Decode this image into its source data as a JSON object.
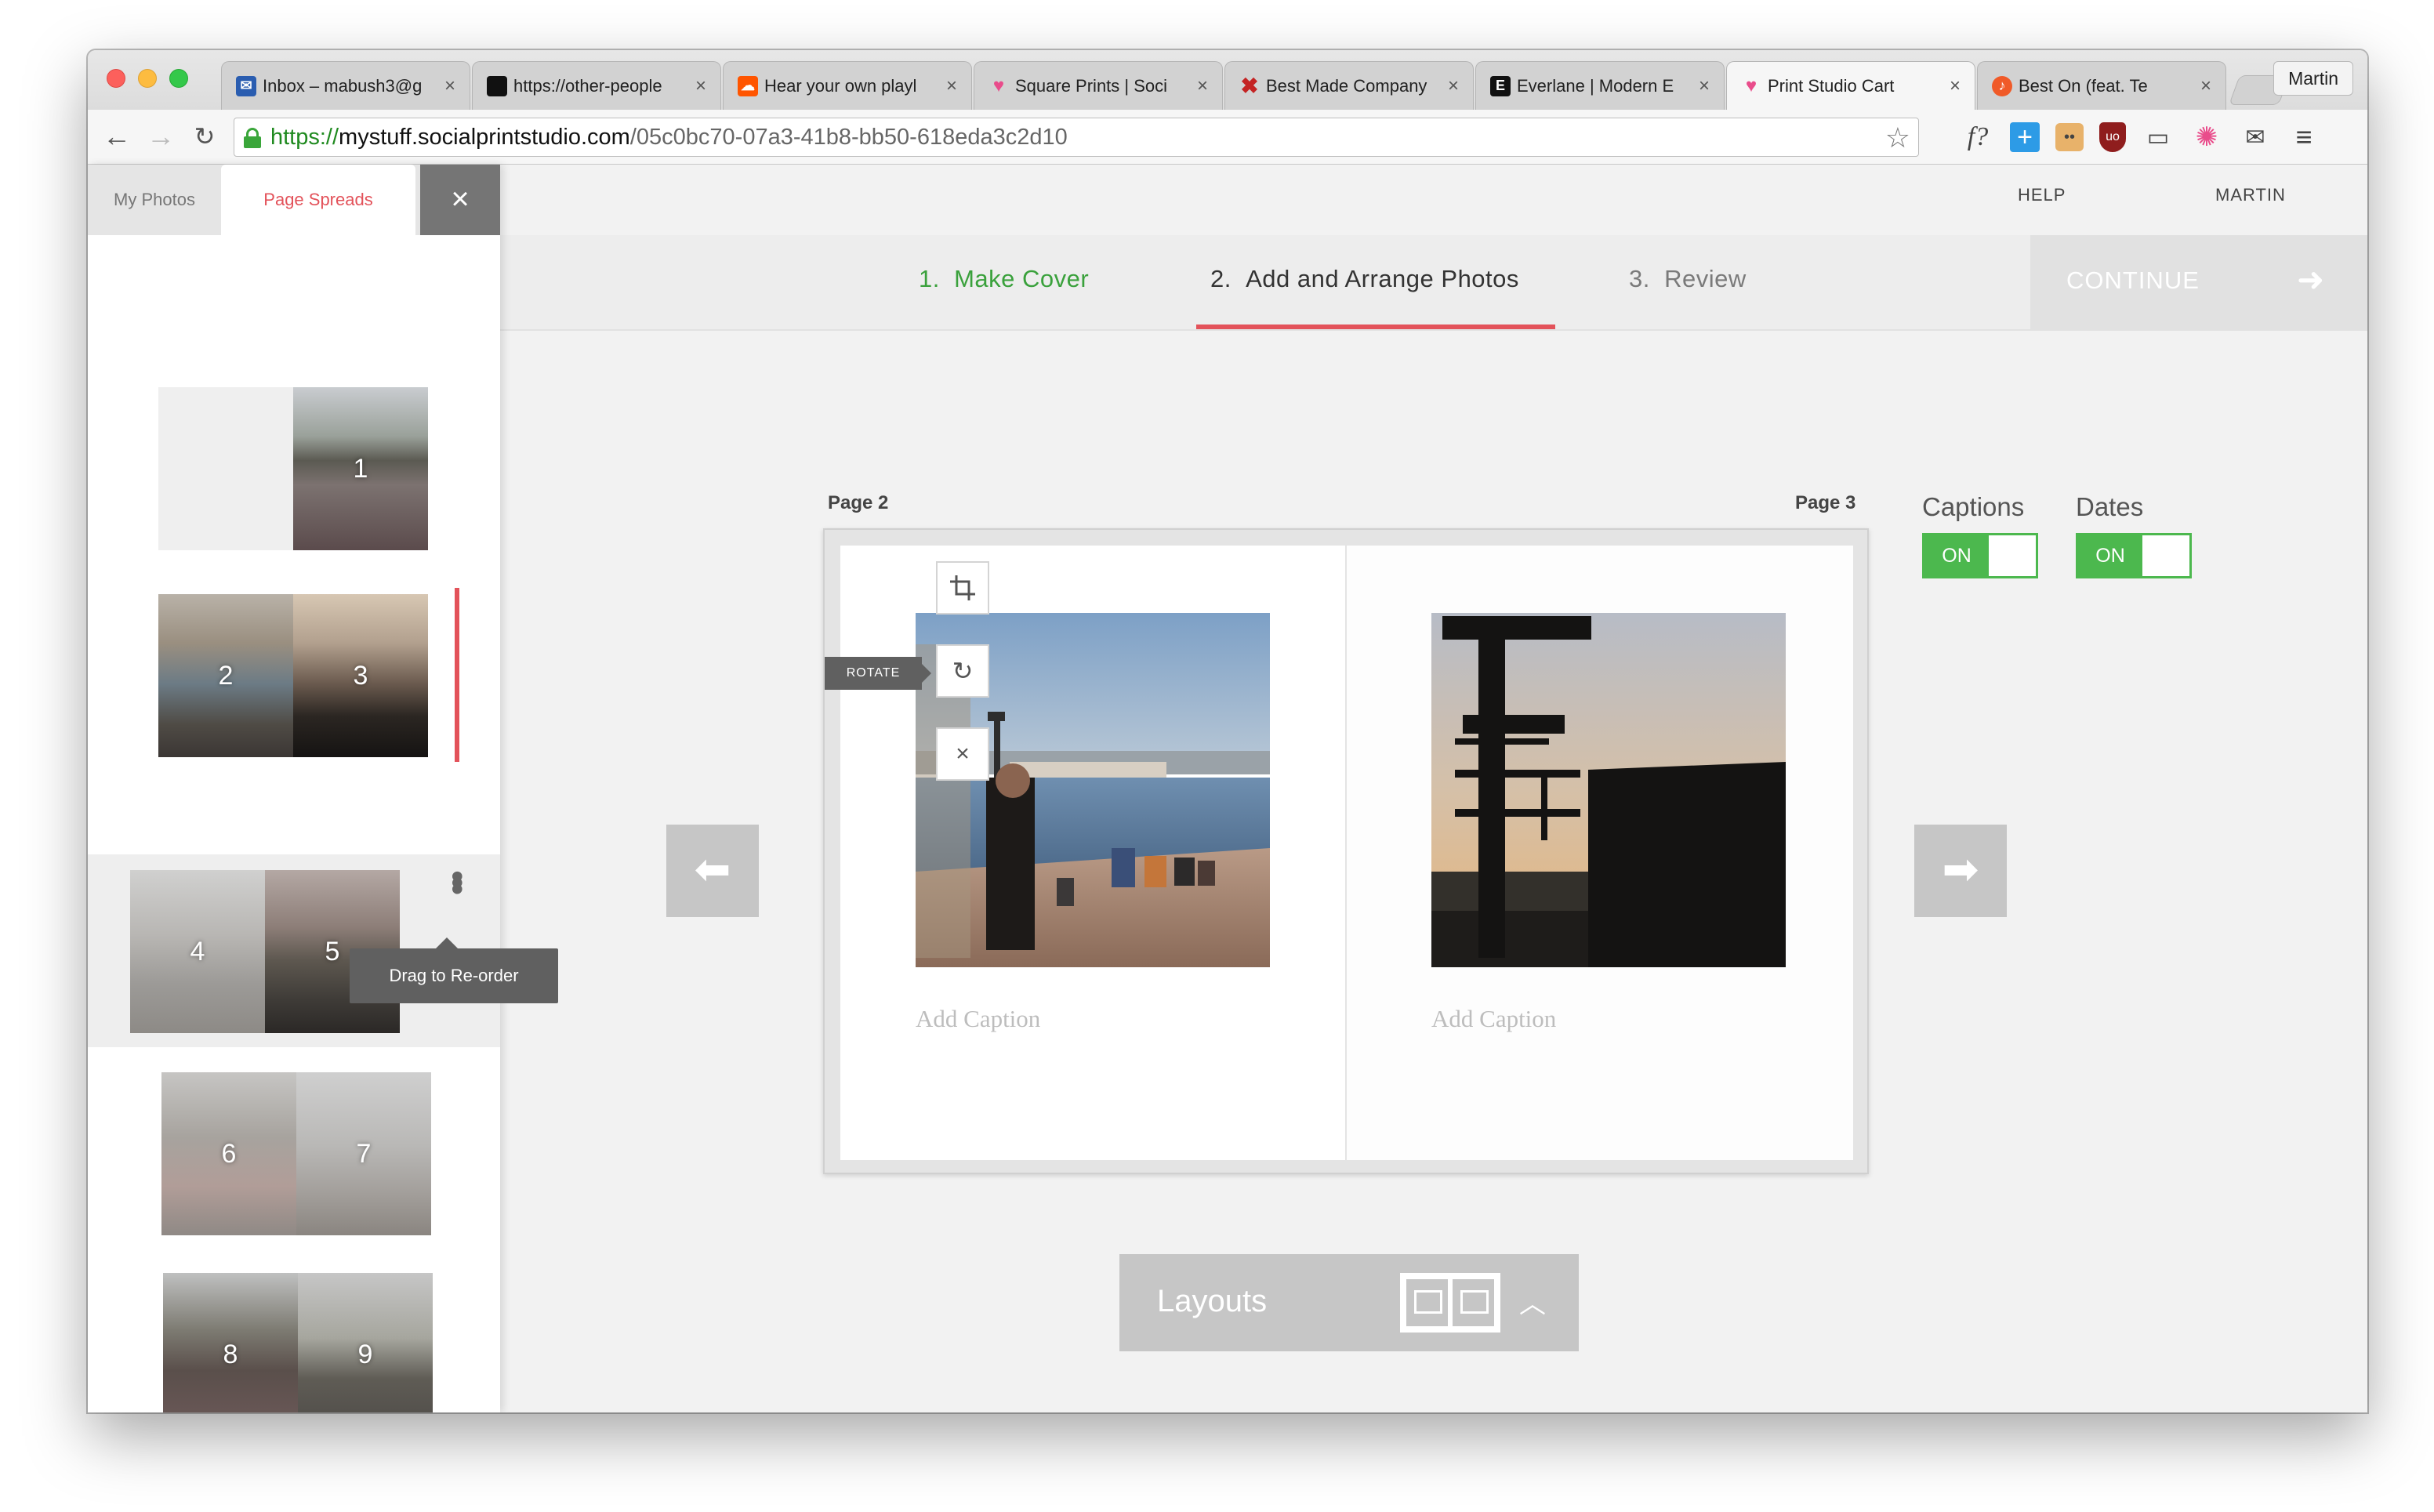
{
  "browser": {
    "tabs": [
      {
        "label": "Inbox – mabush3@g",
        "favicon": "mail-icon",
        "color": "#2a5db0",
        "active": false
      },
      {
        "label": "https://other-people",
        "favicon": "black-square-icon",
        "color": "#111111",
        "active": false
      },
      {
        "label": "Hear your own playl",
        "favicon": "soundcloud-icon",
        "color": "#ff5500",
        "active": false
      },
      {
        "label": "Square Prints | Soci",
        "favicon": "heart-icon",
        "color": "#e94c8b",
        "active": false
      },
      {
        "label": "Best Made Company",
        "favicon": "cross-icon",
        "color": "#c42323",
        "active": false
      },
      {
        "label": "Everlane | Modern E",
        "favicon": "e-icon",
        "color": "#111111",
        "active": false
      },
      {
        "label": "Print Studio Cart",
        "favicon": "heart-icon",
        "color": "#e94c8b",
        "active": true
      },
      {
        "label": "Best On (feat. Te",
        "favicon": "audio-icon",
        "color": "#f05a28",
        "active": false
      }
    ],
    "profile": "Martin",
    "url": {
      "protocol": "https://",
      "host": "mystuff.socialprintstudio.com",
      "path": "/05c0bc70-07a3-41b8-bb50-618eda3c2d10"
    }
  },
  "header": {
    "help": "HELP",
    "user": "MARTIN",
    "help_icon": "?"
  },
  "steps": [
    {
      "num": "1.",
      "label": "Make Cover",
      "state": "done"
    },
    {
      "num": "2.",
      "label": "Add and Arrange Photos",
      "state": "current"
    },
    {
      "num": "3.",
      "label": "Review",
      "state": "todo"
    }
  ],
  "continue_label": "CONTINUE",
  "sidebar": {
    "tab_photos": "My Photos",
    "tab_spreads": "Page Spreads",
    "close": "×",
    "spreads": [
      {
        "left": "",
        "right": "1"
      },
      {
        "left": "2",
        "right": "3"
      },
      {
        "left": "4",
        "right": "5"
      },
      {
        "left": "6",
        "right": "7"
      },
      {
        "left": "8",
        "right": "9"
      }
    ],
    "drag_tip": "Drag to Re-order"
  },
  "book": {
    "left_page_label": "Page 2",
    "right_page_label": "Page 3",
    "left_caption": "Add Caption",
    "right_caption": "Add Caption",
    "rotate_tip": "ROTATE"
  },
  "options": {
    "captions_label": "Captions",
    "captions_state": "ON",
    "dates_label": "Dates",
    "dates_state": "ON"
  },
  "layouts_label": "Layouts",
  "colors": {
    "accent_red": "#e3525a",
    "success_green": "#3aa13c",
    "toggle_green": "#4cb84e"
  }
}
